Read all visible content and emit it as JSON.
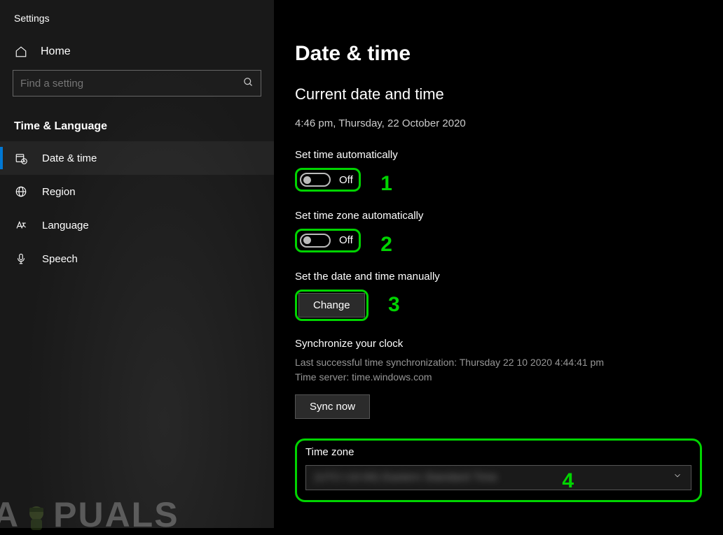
{
  "app_title": "Settings",
  "home_label": "Home",
  "search_placeholder": "Find a setting",
  "category": "Time & Language",
  "sidebar": {
    "items": [
      {
        "label": "Date & time"
      },
      {
        "label": "Region"
      },
      {
        "label": "Language"
      },
      {
        "label": "Speech"
      }
    ]
  },
  "page": {
    "title": "Date & time",
    "section_title": "Current date and time",
    "current_datetime": "4:46 pm, Thursday, 22 October 2020",
    "set_time_auto_label": "Set time automatically",
    "set_time_auto_state": "Off",
    "set_tz_auto_label": "Set time zone automatically",
    "set_tz_auto_state": "Off",
    "set_manual_label": "Set the date and time manually",
    "change_button": "Change",
    "sync_title": "Synchronize your clock",
    "sync_last": "Last successful time synchronization: Thursday 22 10 2020 4:44:41 pm",
    "sync_server": "Time server: time.windows.com",
    "sync_button": "Sync now",
    "tz_label": "Time zone",
    "tz_value": "(UTC+10:00) Eastern Standard Time"
  },
  "annotations": {
    "n1": "1",
    "n2": "2",
    "n3": "3",
    "n4": "4"
  },
  "watermark": "A   PUALS"
}
